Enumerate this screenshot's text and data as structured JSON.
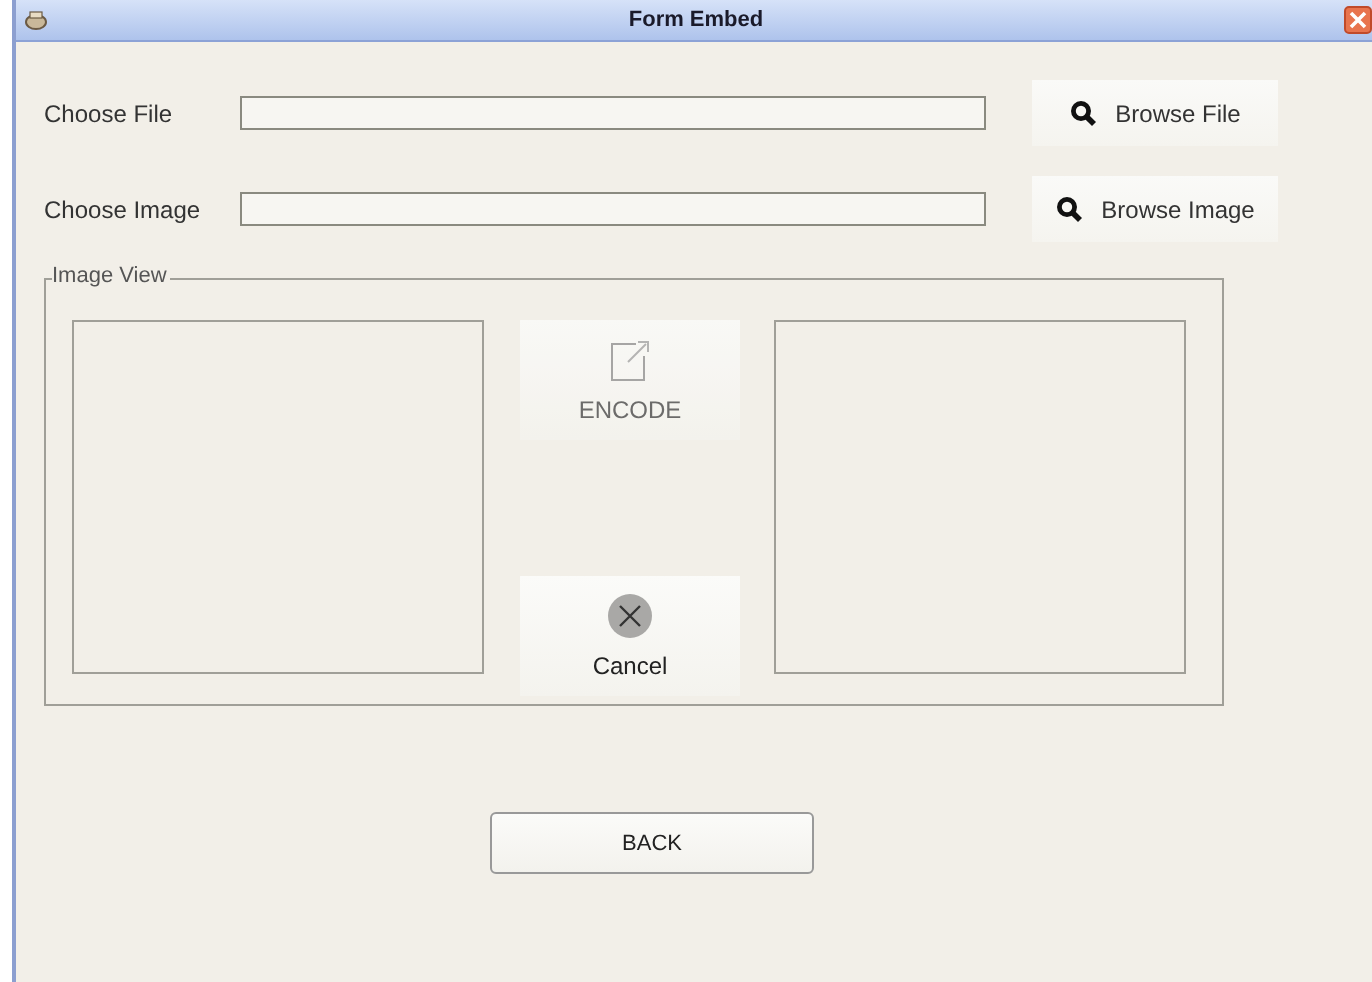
{
  "window": {
    "title": "Form Embed"
  },
  "rows": [
    {
      "label": "Choose File",
      "value": "",
      "button": "Browse File"
    },
    {
      "label": "Choose Image",
      "value": "",
      "button": "Browse Image"
    }
  ],
  "image_view": {
    "title": "Image View",
    "actions": [
      {
        "kind": "encode",
        "label": "ENCODE",
        "disabled": true
      },
      {
        "kind": "cancel",
        "label": "Cancel",
        "disabled": false
      }
    ]
  },
  "back_button": "BACK"
}
